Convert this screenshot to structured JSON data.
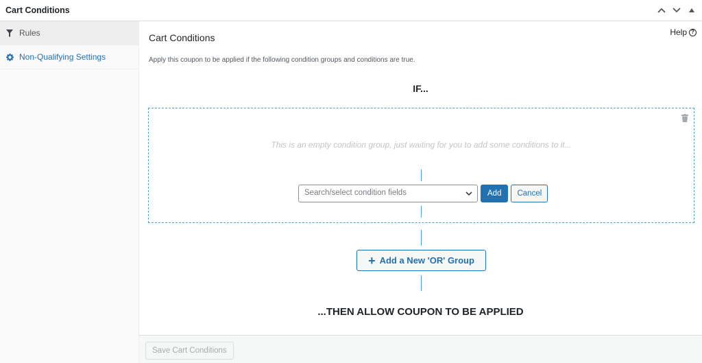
{
  "panel": {
    "title": "Cart Conditions",
    "actions": [
      "move-up",
      "move-down",
      "toggle-panel"
    ]
  },
  "sidebar": {
    "items": [
      {
        "label": "Rules",
        "icon": "filter-icon",
        "active": true
      },
      {
        "label": "Non-Qualifying Settings",
        "icon": "gear-icon",
        "active": false
      }
    ]
  },
  "main": {
    "title": "Cart Conditions",
    "help_label": "Help",
    "description": "Apply this coupon to be applied if the following condition groups and conditions are true.",
    "if_label": "IF...",
    "group": {
      "empty_message": "This is an empty condition group, just waiting for you to add some conditions to it...",
      "select_placeholder": "Search/select condition fields",
      "add_label": "Add",
      "cancel_label": "Cancel"
    },
    "or_group_label": "Add a New 'OR' Group",
    "then_label": "...THEN ALLOW COUPON TO BE APPLIED"
  },
  "footer": {
    "save_label": "Save Cart Conditions"
  },
  "colors": {
    "accent": "#2271b1",
    "dashed_border": "#4fa0c7"
  }
}
